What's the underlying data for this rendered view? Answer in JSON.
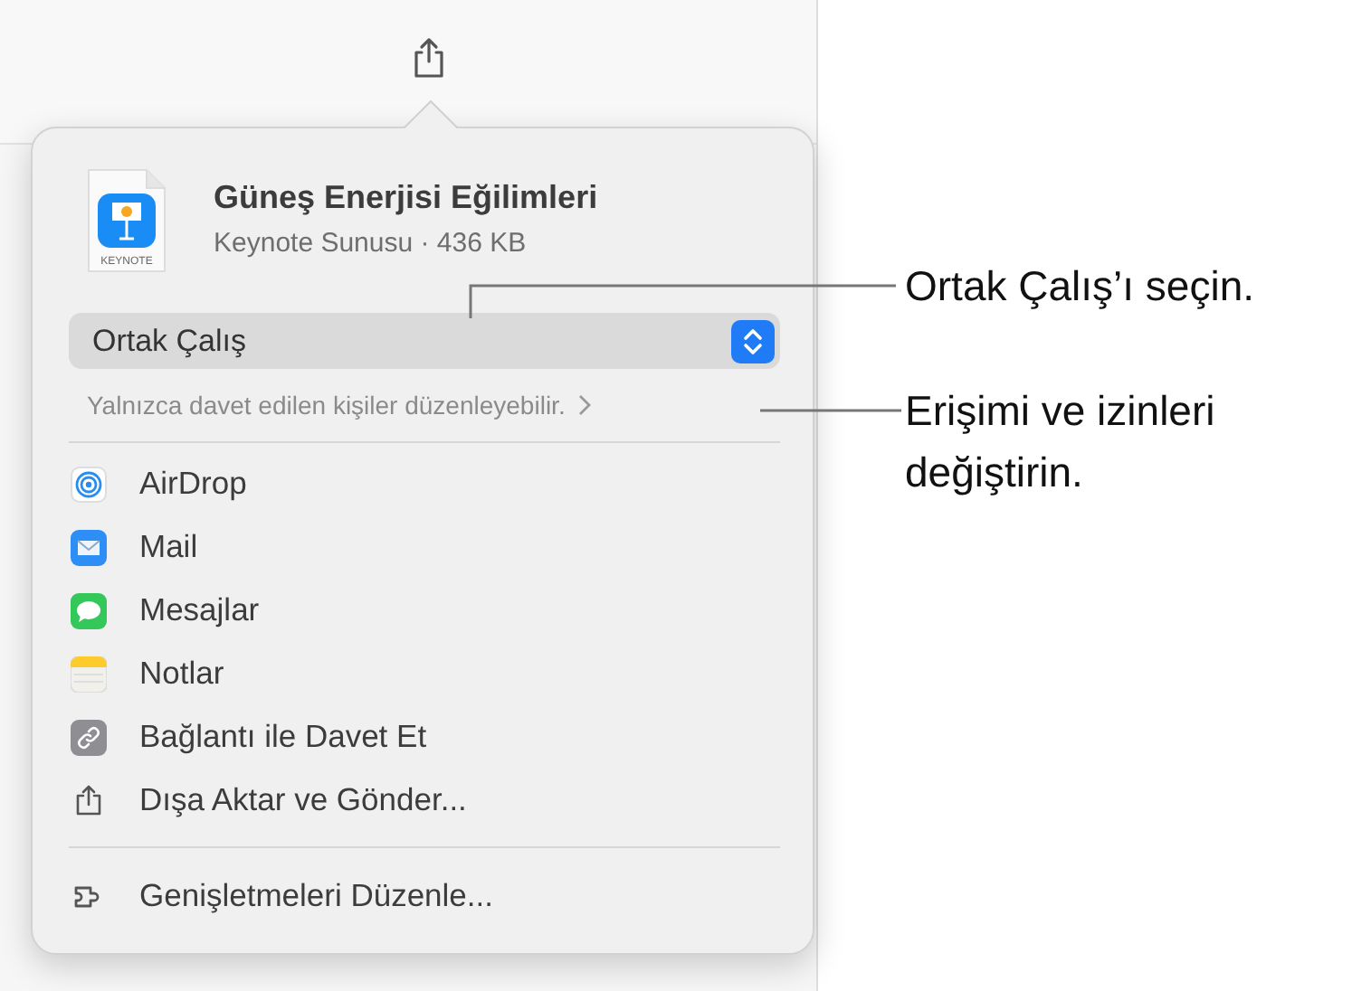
{
  "share_sheet": {
    "file": {
      "title": "Güneş Enerjisi Eğilimleri",
      "subtitle": "Keynote Sunusu · 436 KB",
      "icon_label": "KEYNOTE"
    },
    "collaboration_popup": {
      "value": "Ortak Çalış"
    },
    "access_description": "Yalnızca davet edilen kişiler düzenleyebilir.",
    "options": [
      {
        "kind": "airdrop",
        "label": "AirDrop"
      },
      {
        "kind": "mail",
        "label": "Mail"
      },
      {
        "kind": "messages",
        "label": "Mesajlar"
      },
      {
        "kind": "notes",
        "label": "Notlar"
      },
      {
        "kind": "link",
        "label": "Bağlantı ile Davet Et"
      },
      {
        "kind": "export",
        "label": "Dışa Aktar ve Gönder..."
      }
    ],
    "extensions_item": {
      "label": "Genişletmeleri Düzenle..."
    }
  },
  "callouts": [
    {
      "text": "Ortak Çalış’ı seçin."
    },
    {
      "text": "Erişimi ve izinleri değiştirin."
    }
  ]
}
